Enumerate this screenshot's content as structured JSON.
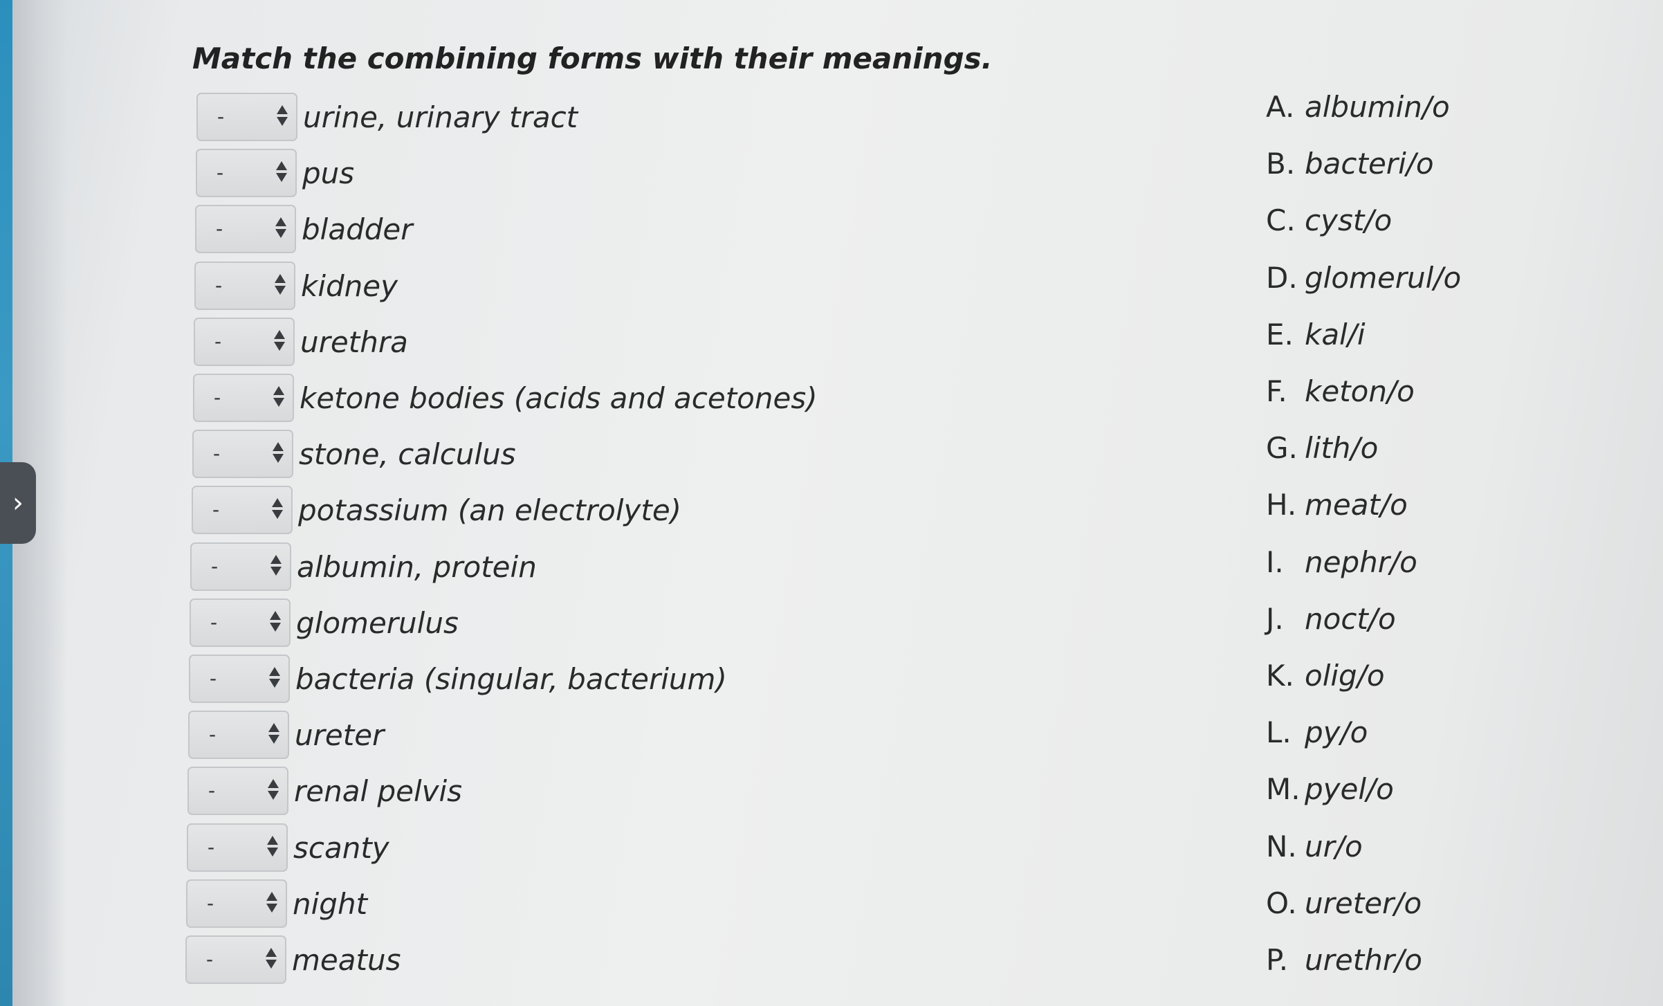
{
  "title": "Match the combining forms with their meanings.",
  "placeholder": "-",
  "questions": [
    {
      "text": "urine, urinary tract",
      "value": "-"
    },
    {
      "text": "pus",
      "value": "-"
    },
    {
      "text": "bladder",
      "value": "-"
    },
    {
      "text": "kidney",
      "value": "-"
    },
    {
      "text": "urethra",
      "value": "-"
    },
    {
      "text": "ketone bodies (acids and acetones)",
      "value": "-"
    },
    {
      "text": "stone, calculus",
      "value": "-"
    },
    {
      "text": "potassium (an electrolyte)",
      "value": "-"
    },
    {
      "text": "albumin, protein",
      "value": "-"
    },
    {
      "text": "glomerulus",
      "value": "-"
    },
    {
      "text": "bacteria (singular, bacterium)",
      "value": "-"
    },
    {
      "text": "ureter",
      "value": "-"
    },
    {
      "text": "renal pelvis",
      "value": "-"
    },
    {
      "text": "scanty",
      "value": "-"
    },
    {
      "text": "night",
      "value": "-"
    },
    {
      "text": "meatus",
      "value": "-"
    }
  ],
  "answers": [
    {
      "letter": "A.",
      "form": "albumin/o"
    },
    {
      "letter": "B.",
      "form": "bacteri/o"
    },
    {
      "letter": "C.",
      "form": "cyst/o"
    },
    {
      "letter": "D.",
      "form": "glomerul/o"
    },
    {
      "letter": "E.",
      "form": "kal/i"
    },
    {
      "letter": "F.",
      "form": "keton/o"
    },
    {
      "letter": "G.",
      "form": "lith/o"
    },
    {
      "letter": "H.",
      "form": "meat/o"
    },
    {
      "letter": "I.",
      "form": "nephr/o"
    },
    {
      "letter": "J.",
      "form": "noct/o"
    },
    {
      "letter": "K.",
      "form": "olig/o"
    },
    {
      "letter": "L.",
      "form": "py/o"
    },
    {
      "letter": "M.",
      "form": "pyel/o"
    },
    {
      "letter": "N.",
      "form": "ur/o"
    },
    {
      "letter": "O.",
      "form": "ureter/o"
    },
    {
      "letter": "P.",
      "form": "urethr/o"
    }
  ],
  "side_toggle": {
    "glyph": "›",
    "icon": "chevron-right-icon"
  }
}
